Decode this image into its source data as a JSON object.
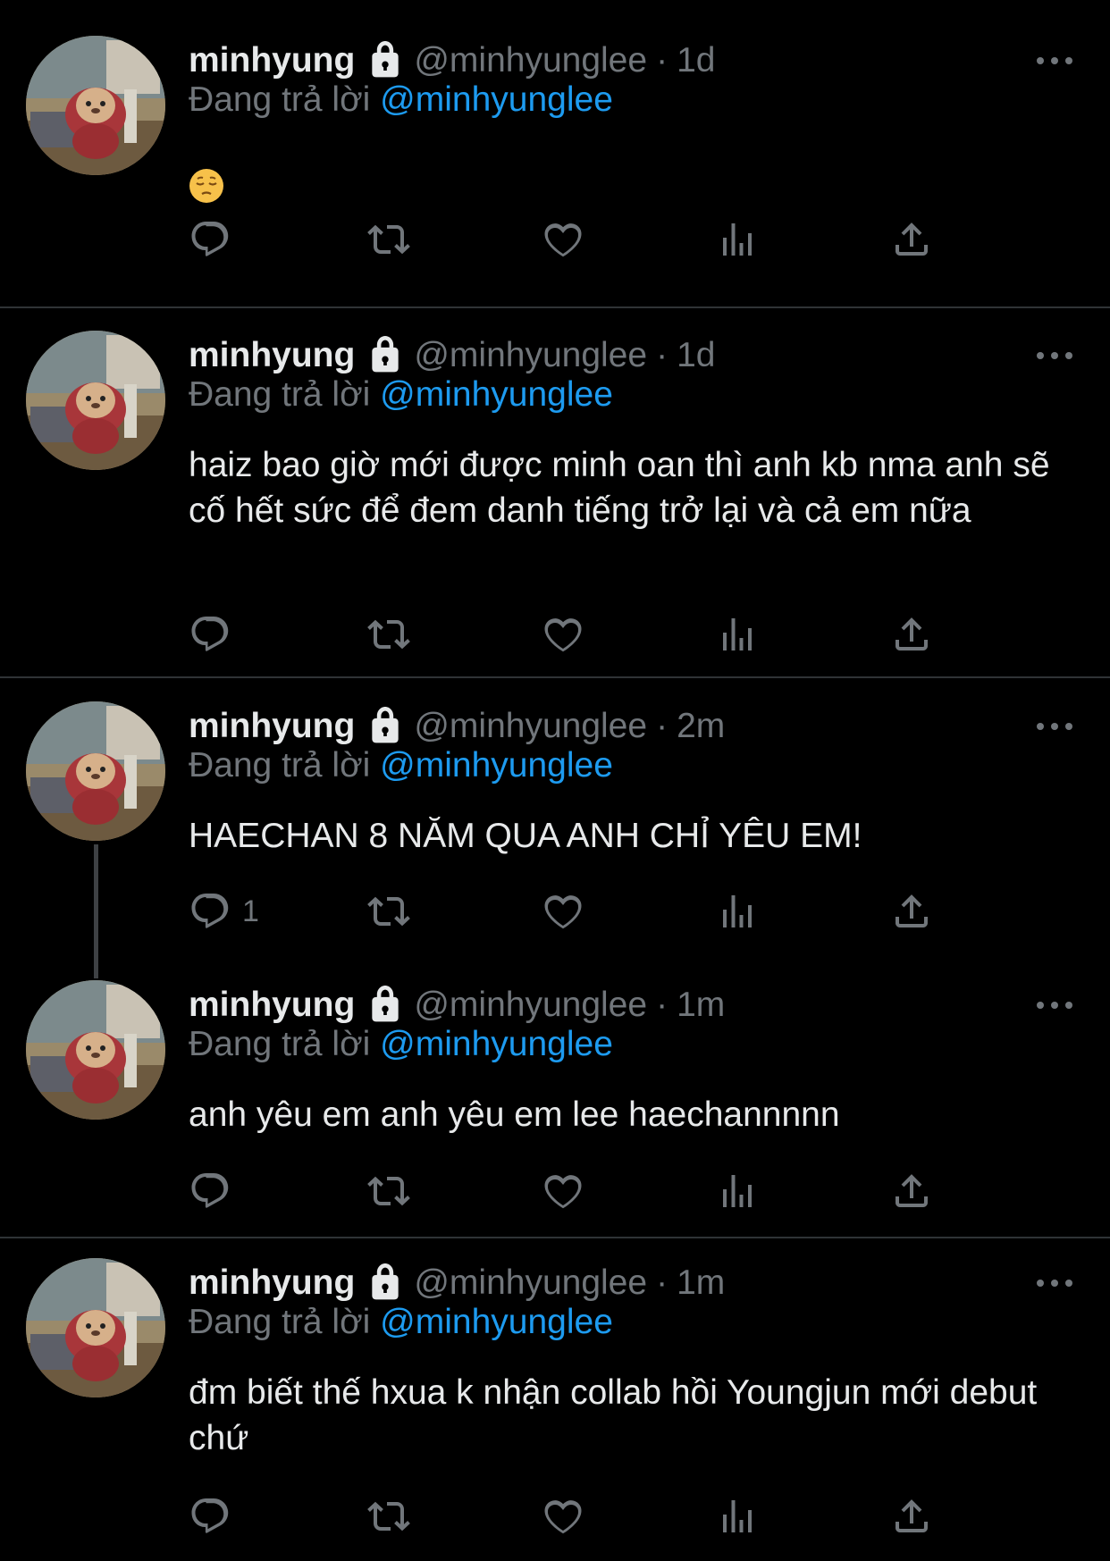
{
  "tweets": [
    {
      "name": "minhyung",
      "handle": "@minhyunglee",
      "dot": "·",
      "time": "1d",
      "replying_prefix": "Đang trả lời",
      "replying_to": "@minhyunglee",
      "text": "",
      "emoji": "pensive-face",
      "reply_count": ""
    },
    {
      "name": "minhyung",
      "handle": "@minhyunglee",
      "dot": "·",
      "time": "1d",
      "replying_prefix": "Đang trả lời",
      "replying_to": "@minhyunglee",
      "text": "haiz bao giờ mới được minh oan thì anh kb nma anh sẽ cố hết sức để đem danh tiếng trở lại và cả em nữa",
      "reply_count": ""
    },
    {
      "name": "minhyung",
      "handle": "@minhyunglee",
      "dot": "·",
      "time": "2m",
      "replying_prefix": "Đang trả lời",
      "replying_to": "@minhyunglee",
      "text": "HAECHAN 8 NĂM QUA ANH CHỈ YÊU EM!",
      "reply_count": "1"
    },
    {
      "name": "minhyung",
      "handle": "@minhyunglee",
      "dot": "·",
      "time": "1m",
      "replying_prefix": "Đang trả lời",
      "replying_to": "@minhyunglee",
      "text": "anh yêu em anh yêu em lee haechannnnn",
      "reply_count": ""
    },
    {
      "name": "minhyung",
      "handle": "@minhyunglee",
      "dot": "·",
      "time": "1m",
      "replying_prefix": "Đang trả lời",
      "replying_to": "@minhyunglee",
      "text": "đm biết thế hxua k nhận collab hồi Youngjun mới debut chứ",
      "reply_count": ""
    }
  ],
  "icons": {
    "reply": "reply-icon",
    "retweet": "retweet-icon",
    "like": "heart-icon",
    "views": "analytics-icon",
    "share": "share-icon",
    "more": "more-icon",
    "lock": "lock-icon"
  },
  "colors": {
    "background": "#000000",
    "text": "#e7e9ea",
    "secondary": "#71767b",
    "mention": "#1d9bf0",
    "divider": "#2f3336"
  }
}
